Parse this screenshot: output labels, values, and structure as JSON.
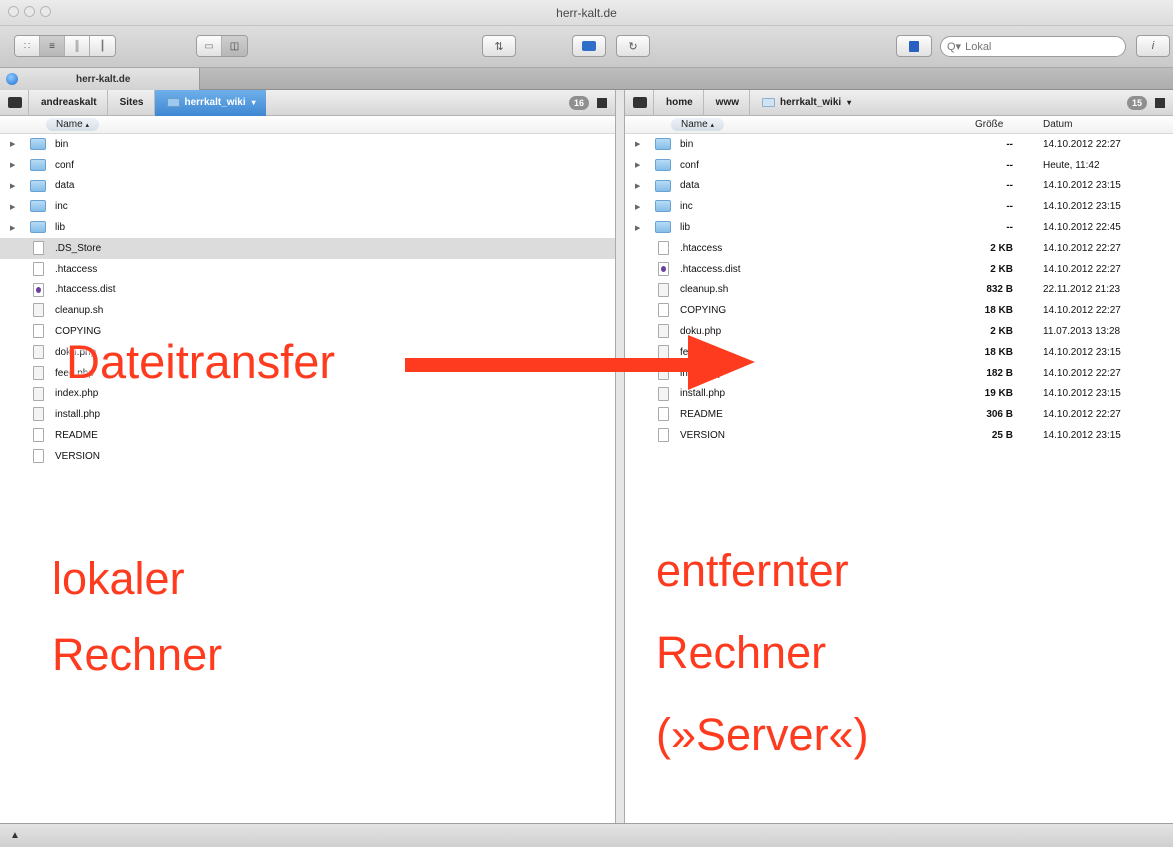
{
  "window": {
    "title": "herr-kalt.de"
  },
  "toolbar": {
    "search_placeholder": "Lokal",
    "search_prefix": "Q▾",
    "info_label": "i"
  },
  "tab": {
    "label": "herr-kalt.de"
  },
  "left": {
    "path": [
      "andreaskalt",
      "Sites",
      "herrkalt_wiki"
    ],
    "count": "16",
    "column_name": "Name",
    "files": [
      {
        "name": "bin",
        "type": "folder"
      },
      {
        "name": "conf",
        "type": "folder"
      },
      {
        "name": "data",
        "type": "folder"
      },
      {
        "name": "inc",
        "type": "folder"
      },
      {
        "name": "lib",
        "type": "folder"
      },
      {
        "name": ".DS_Store",
        "type": "file",
        "highlight": true
      },
      {
        "name": ".htaccess",
        "type": "file"
      },
      {
        "name": ".htaccess.dist",
        "type": "dist"
      },
      {
        "name": "cleanup.sh",
        "type": "php"
      },
      {
        "name": "COPYING",
        "type": "file"
      },
      {
        "name": "doku.php",
        "type": "php"
      },
      {
        "name": "feed.php",
        "type": "php"
      },
      {
        "name": "index.php",
        "type": "php"
      },
      {
        "name": "install.php",
        "type": "php"
      },
      {
        "name": "README",
        "type": "file"
      },
      {
        "name": "VERSION",
        "type": "file"
      }
    ]
  },
  "right": {
    "path": [
      "home",
      "www",
      "herrkalt_wiki"
    ],
    "count": "15",
    "column_name": "Name",
    "column_size": "Größe",
    "column_date": "Datum",
    "files": [
      {
        "name": "bin",
        "type": "folder",
        "size": "--",
        "date": "14.10.2012 22:27"
      },
      {
        "name": "conf",
        "type": "folder",
        "size": "--",
        "date": "Heute, 11:42"
      },
      {
        "name": "data",
        "type": "folder",
        "size": "--",
        "date": "14.10.2012 23:15"
      },
      {
        "name": "inc",
        "type": "folder",
        "size": "--",
        "date": "14.10.2012 23:15"
      },
      {
        "name": "lib",
        "type": "folder",
        "size": "--",
        "date": "14.10.2012 22:45"
      },
      {
        "name": ".htaccess",
        "type": "file",
        "size": "2 KB",
        "date": "14.10.2012 22:27"
      },
      {
        "name": ".htaccess.dist",
        "type": "dist",
        "size": "2 KB",
        "date": "14.10.2012 22:27"
      },
      {
        "name": "cleanup.sh",
        "type": "php",
        "size": "832 B",
        "date": "22.11.2012 21:23"
      },
      {
        "name": "COPYING",
        "type": "file",
        "size": "18 KB",
        "date": "14.10.2012 22:27"
      },
      {
        "name": "doku.php",
        "type": "php",
        "size": "2 KB",
        "date": "11.07.2013 13:28"
      },
      {
        "name": "feed.php",
        "type": "php",
        "size": "18 KB",
        "date": "14.10.2012 23:15"
      },
      {
        "name": "index.php",
        "type": "php",
        "size": "182 B",
        "date": "14.10.2012 22:27"
      },
      {
        "name": "install.php",
        "type": "php",
        "size": "19 KB",
        "date": "14.10.2012 23:15"
      },
      {
        "name": "README",
        "type": "file",
        "size": "306 B",
        "date": "14.10.2012 22:27"
      },
      {
        "name": "VERSION",
        "type": "file",
        "size": "25 B",
        "date": "14.10.2012 23:15"
      }
    ]
  },
  "annotations": {
    "transfer": "Dateitransfer",
    "local_line1": "lokaler",
    "local_line2": "Rechner",
    "remote_line1": "entfernter",
    "remote_line2": "Rechner",
    "remote_line3": "(»Server«)"
  },
  "colors": {
    "annotation": "#ff3b1f",
    "selection": "#3f87d3"
  }
}
